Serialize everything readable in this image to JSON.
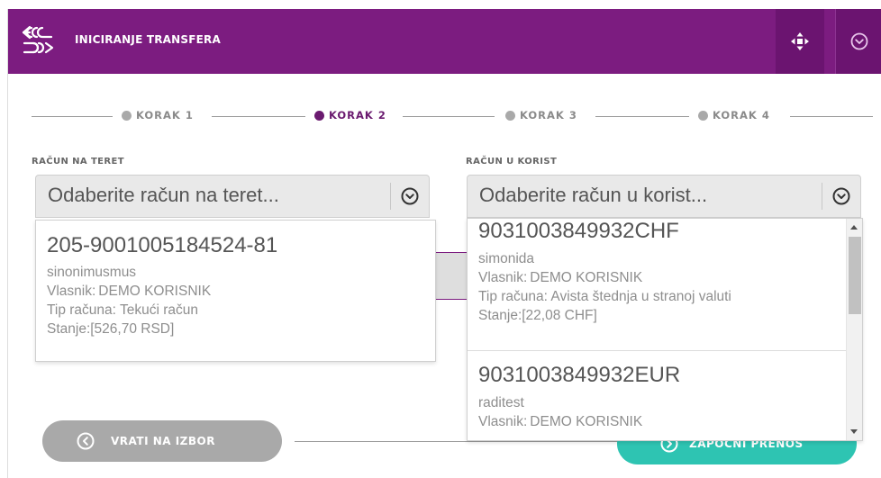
{
  "header": {
    "title": "INICIRANJE TRANSFERA",
    "background": "#7c1c80"
  },
  "steps": [
    {
      "label": "KORAK 1",
      "active": false
    },
    {
      "label": "KORAK 2",
      "active": true
    },
    {
      "label": "KORAK 3",
      "active": false
    },
    {
      "label": "KORAK 4",
      "active": false
    }
  ],
  "debit": {
    "section_label": "RAČUN NA TERET",
    "placeholder": "Odaberite račun na teret...",
    "selected": {
      "number": "205-9001005184524-81",
      "alias": "sinonimusmus",
      "owner_label": "Vlasnik:",
      "owner": "DEMO KORISNIK",
      "type": "Tip računa: Tekući račun",
      "balance": "Stanje:[526,70 RSD]"
    }
  },
  "credit": {
    "section_label": "RAČUN U KORIST",
    "placeholder": "Odaberite račun u korist...",
    "options": [
      {
        "number": "9031003849932CHF",
        "alias": "simonida",
        "owner_label": "Vlasnik:",
        "owner": "DEMO KORISNIK",
        "type": "Tip računa: Avista štednja u stranoj valuti",
        "balance": "Stanje:[22,08 CHF]"
      },
      {
        "number": "9031003849932EUR",
        "alias": "raditest",
        "owner_label": "Vlasnik:",
        "owner": "DEMO KORISNIK"
      }
    ]
  },
  "buttons": {
    "back": "VRATI NA IZBOR",
    "start": "ZAPOČNI PRENOS"
  },
  "colors": {
    "accent": "#6a1a6f",
    "teal": "#2ec4b2",
    "gray_button": "#a9a9a9"
  },
  "icons": {
    "logo": "transfer-logo-icon",
    "move": "move-arrows-icon",
    "collapse": "chevron-circle-down-icon",
    "select_chevron": "chevron-circle-down-icon",
    "back": "chevron-circle-left-icon",
    "start": "chevron-circle-right-icon"
  }
}
